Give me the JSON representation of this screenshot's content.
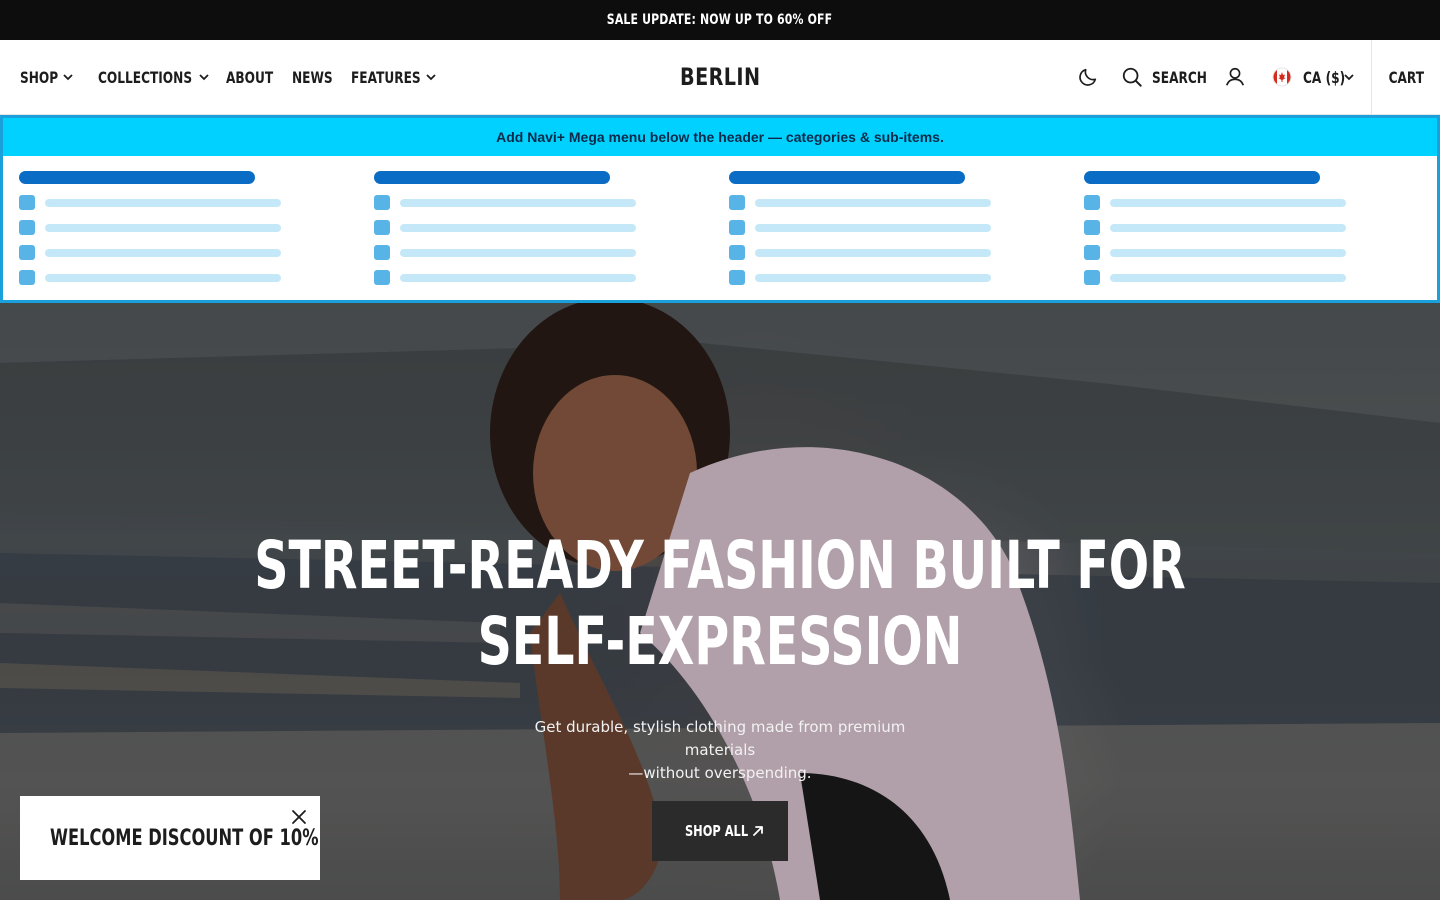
{
  "announcement": {
    "text": "SALE UPDATE: NOW UP TO 60% OFF"
  },
  "header": {
    "nav": [
      {
        "label": "SHOP",
        "has_dropdown": true
      },
      {
        "label": "COLLECTIONS",
        "has_dropdown": true
      },
      {
        "label": "ABOUT",
        "has_dropdown": false
      },
      {
        "label": "NEWS",
        "has_dropdown": false
      },
      {
        "label": "FEATURES",
        "has_dropdown": true
      }
    ],
    "logo": "BERLIN",
    "theme_toggle_icon": "moon-icon",
    "search_label": "SEARCH",
    "account_icon": "user-icon",
    "currency": {
      "flag": "canada-flag-icon",
      "label": "CA ($)"
    },
    "cart_label": "CART"
  },
  "mega_menu": {
    "banner_text": "Add Navi+ Mega menu below the header — categories & sub-items.",
    "colors": {
      "banner": "#00d1ff",
      "border": "#1aa1dc",
      "title_bar": "#0a6cc4",
      "item_square": "#58b4e6",
      "item_line": "#c5e8f8"
    },
    "columns": 4,
    "items_per_column": 4
  },
  "hero": {
    "title_line1": "STREET-READY FASHION BUILT FOR",
    "title_line2": "SELF-EXPRESSION",
    "subtitle_line1": "Get durable, stylish clothing made from premium materials",
    "subtitle_line2": "—without overspending.",
    "button_label": "SHOP ALL"
  },
  "popup": {
    "text": "WELCOME DISCOUNT OF 10%"
  }
}
